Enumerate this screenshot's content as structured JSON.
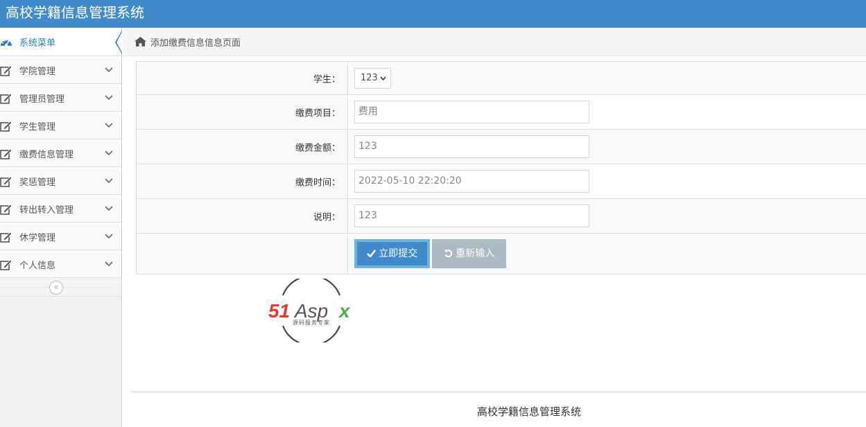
{
  "header": {
    "title": "高校学籍信息管理系统"
  },
  "sidebar": {
    "head": {
      "label": "系统菜单",
      "icon": "dashboard-icon"
    },
    "items": [
      {
        "label": "学院管理",
        "icon": "edit-icon"
      },
      {
        "label": "管理员管理",
        "icon": "edit-icon"
      },
      {
        "label": "学生管理",
        "icon": "edit-icon"
      },
      {
        "label": "缴费信息管理",
        "icon": "edit-icon"
      },
      {
        "label": "奖惩管理",
        "icon": "edit-icon"
      },
      {
        "label": "转出转入管理",
        "icon": "edit-icon"
      },
      {
        "label": "休学管理",
        "icon": "edit-icon"
      },
      {
        "label": "个人信息",
        "icon": "edit-icon"
      }
    ],
    "collapse_glyph": "«"
  },
  "breadcrumb": {
    "text": "添加缴费信息信息页面"
  },
  "form": {
    "student": {
      "label": "学生：",
      "value": "123"
    },
    "item": {
      "label": "缴费项目：",
      "placeholder": "费用"
    },
    "amount": {
      "label": "缴费金额：",
      "value": "123"
    },
    "time": {
      "label": "缴费时间：",
      "value": "2022-05-10 22:20:20"
    },
    "note": {
      "label": "说明：",
      "value": "123"
    },
    "submit_label": "立即提交",
    "reset_label": "重新输入"
  },
  "logo": {
    "text": "51Aspx",
    "subtext": "源码服务专家"
  },
  "footer": {
    "text": "高校学籍信息管理系统"
  },
  "colors": {
    "header": "#428bca",
    "submit": "#428bca",
    "reset": "#abbac3",
    "logo_red": "#e43a2f",
    "logo_green": "#4caf50"
  }
}
